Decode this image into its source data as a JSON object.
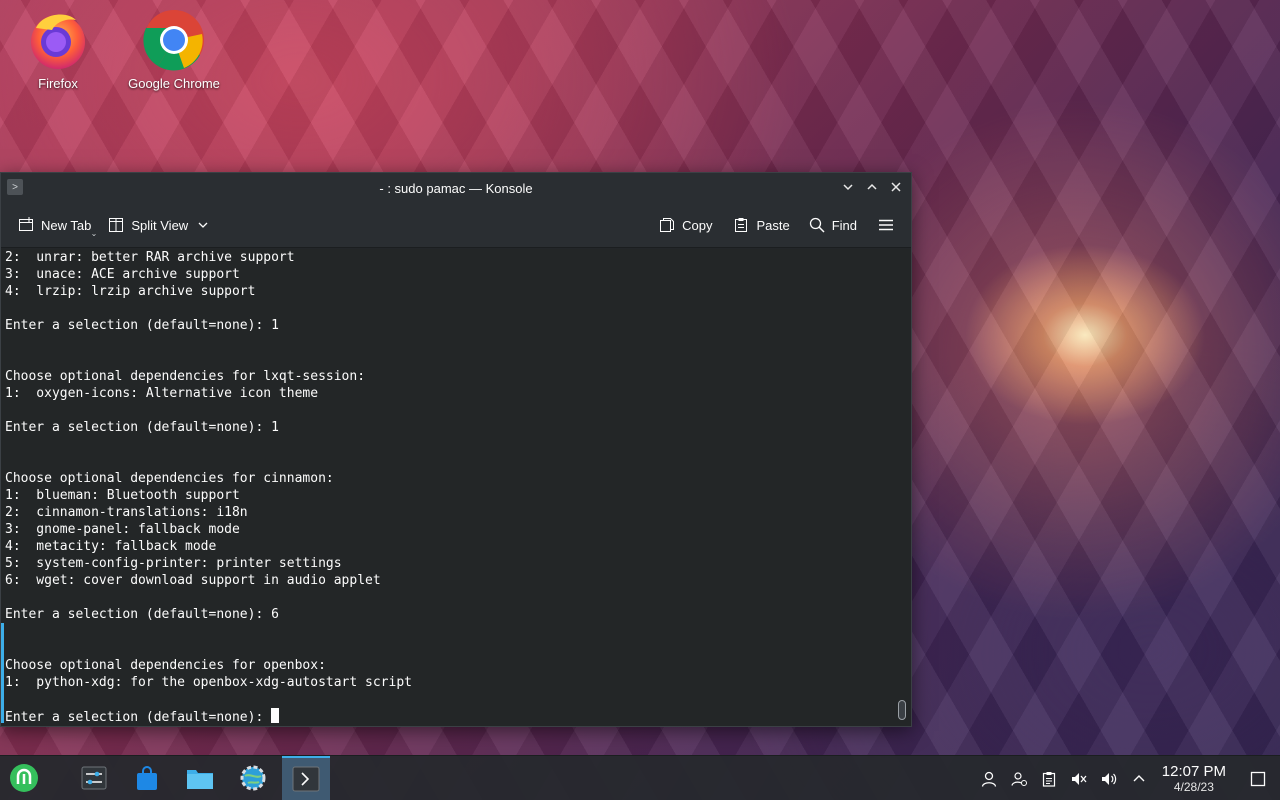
{
  "desktop": {
    "icons": [
      {
        "label": "Firefox",
        "icon": "firefox-icon"
      },
      {
        "label": "Google Chrome",
        "icon": "chrome-icon"
      }
    ]
  },
  "window": {
    "title": "- : sudo pamac — Konsole",
    "toolbar": {
      "new_tab": "New Tab",
      "split_view": "Split View",
      "copy": "Copy",
      "paste": "Paste",
      "find": "Find"
    },
    "terminal_lines": [
      "2:  unrar: better RAR archive support",
      "3:  unace: ACE archive support",
      "4:  lrzip: lrzip archive support",
      "",
      "Enter a selection (default=none): 1",
      "",
      "",
      "Choose optional dependencies for lxqt-session:",
      "1:  oxygen-icons: Alternative icon theme",
      "",
      "Enter a selection (default=none): 1",
      "",
      "",
      "Choose optional dependencies for cinnamon:",
      "1:  blueman: Bluetooth support",
      "2:  cinnamon-translations: i18n",
      "3:  gnome-panel: fallback mode",
      "4:  metacity: fallback mode",
      "5:  system-config-printer: printer settings",
      "6:  wget: cover download support in audio applet",
      "",
      "Enter a selection (default=none): 6",
      "",
      "",
      "Choose optional dependencies for openbox:",
      "1:  python-xdg: for the openbox-xdg-autostart script",
      ""
    ],
    "prompt": "Enter a selection (default=none): "
  },
  "taskbar": {
    "clock_time": "12:07 PM",
    "clock_date": "4/28/23",
    "colors": {
      "accent": "#3daee9",
      "panel": "#26292e"
    }
  }
}
